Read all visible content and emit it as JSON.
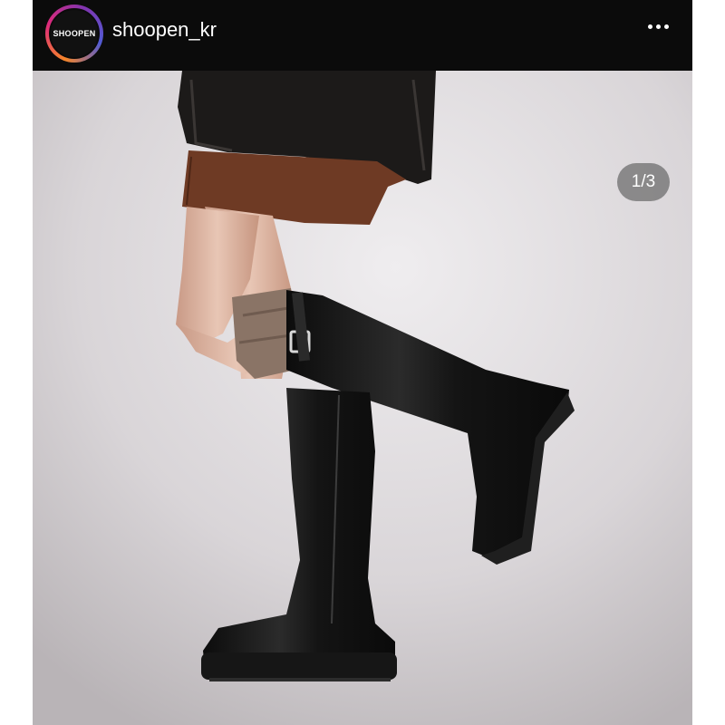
{
  "post": {
    "username": "shoopen_kr",
    "avatar_text": "SHOOPEN",
    "more_icon": "more-horizontal-icon",
    "carousel_counter": "1/3"
  },
  "colors": {
    "header_bg": "#0b0b0b",
    "backdrop": "#d9d6d8",
    "skirt": "#6e3a24",
    "jacket": "#1c1a19",
    "boot": "#121212",
    "sock": "#8a7466",
    "skin": "#d9b3a0"
  }
}
